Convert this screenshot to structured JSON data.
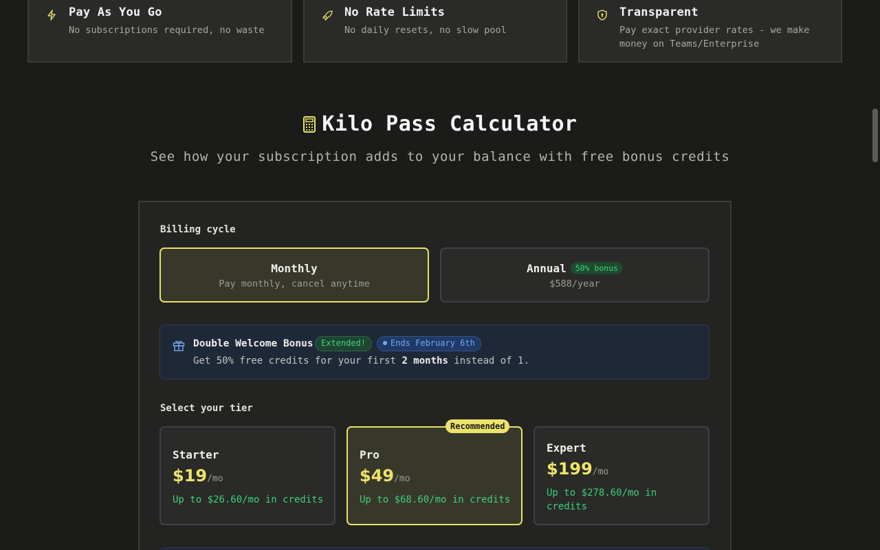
{
  "features": [
    {
      "title": "Pay As You Go",
      "desc": "No subscriptions required, no waste",
      "icon": "lightning-icon"
    },
    {
      "title": "No Rate Limits",
      "desc": "No daily resets, no slow pool",
      "icon": "rocket-icon"
    },
    {
      "title": "Transparent",
      "desc": "Pay exact provider rates - we make money on Teams/Enterprise",
      "icon": "shield-icon"
    }
  ],
  "calculator": {
    "title": "Kilo Pass Calculator",
    "subtitle": "See how your subscription adds to your balance with free bonus credits",
    "billing_label": "Billing cycle",
    "monthly": {
      "title": "Monthly",
      "sub": "Pay monthly, cancel anytime"
    },
    "annual": {
      "title": "Annual",
      "badge": "50% bonus",
      "sub": "$588/year"
    },
    "bonus": {
      "title": "Double Welcome Bonus",
      "pill_extended": "Extended!",
      "pill_ends": "Ends February 6th",
      "desc_pre": "Get 50% free credits for your first ",
      "desc_bold": "2 months",
      "desc_post": " instead of 1."
    },
    "tier_label": "Select your tier",
    "recommended": "Recommended",
    "tiers": [
      {
        "name": "Starter",
        "price": "$19",
        "per": "/mo",
        "credits": "Up to $26.60/mo in credits"
      },
      {
        "name": "Pro",
        "price": "$49",
        "per": "/mo",
        "credits": "Up to $68.60/mo in credits"
      },
      {
        "name": "Expert",
        "price": "$199",
        "per": "/mo",
        "credits": "Up to $278.60/mo in credits"
      }
    ]
  },
  "colors": {
    "accent": "#e8e26a",
    "success": "#3fcf7a",
    "info": "#74a8f2",
    "background": "#1b1b19"
  }
}
